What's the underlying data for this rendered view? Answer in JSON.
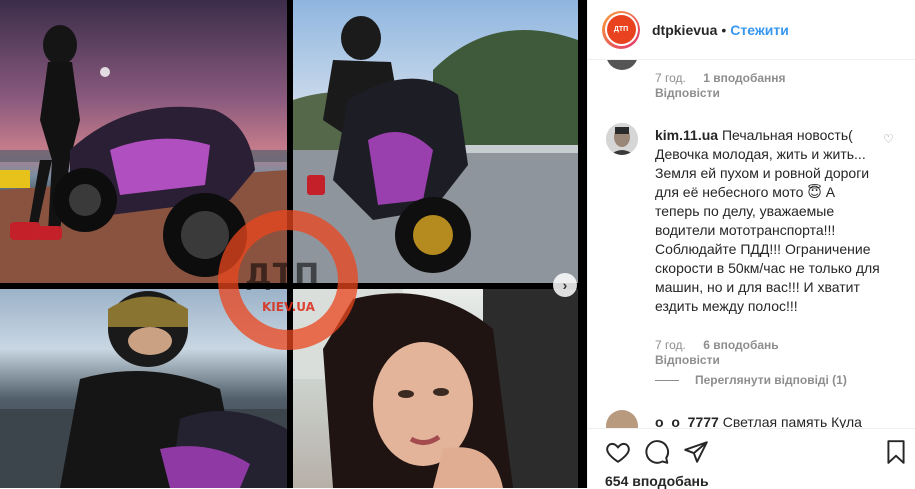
{
  "post": {
    "username": "dtpkievua",
    "separator": "•",
    "follow_label": "Стежити",
    "logo_text": "ДТП",
    "watermark_main": "ДТП",
    "watermark_sub": "KIEV.UA"
  },
  "comments": [
    {
      "time": "7 год.",
      "likes": "1 вподобання",
      "reply_label": "Відповісти"
    },
    {
      "user": "kim.11.ua",
      "text": "Печальная новость( Девочка молодая, жить и жить... Земля ей пухом и ровной дороги для её небесного мото 😇 А теперь по делу, уважаемые водители мототранспорта!!! Соблюдайте ПДД!!! Ограничение скорости в 50км/час не только для машин, но и для вас!!! И хватит ездить между полос!!!",
      "time": "7 год.",
      "likes": "6 вподобань",
      "reply_label": "Відповісти",
      "view_replies": "Переглянути відповіді (1)"
    },
    {
      "user": "o_o_7777",
      "text": "Светлая память Кула"
    }
  ],
  "footer": {
    "likes_count": "654 вподобань"
  },
  "icons": {
    "heart": "heart-icon",
    "comment": "comment-icon",
    "share": "share-icon",
    "bookmark": "bookmark-icon",
    "next": "chevron-right-icon"
  },
  "colors": {
    "accent": "#3897f0",
    "text": "#262626",
    "muted": "#8e8e8e",
    "brand": "#e8421f"
  }
}
